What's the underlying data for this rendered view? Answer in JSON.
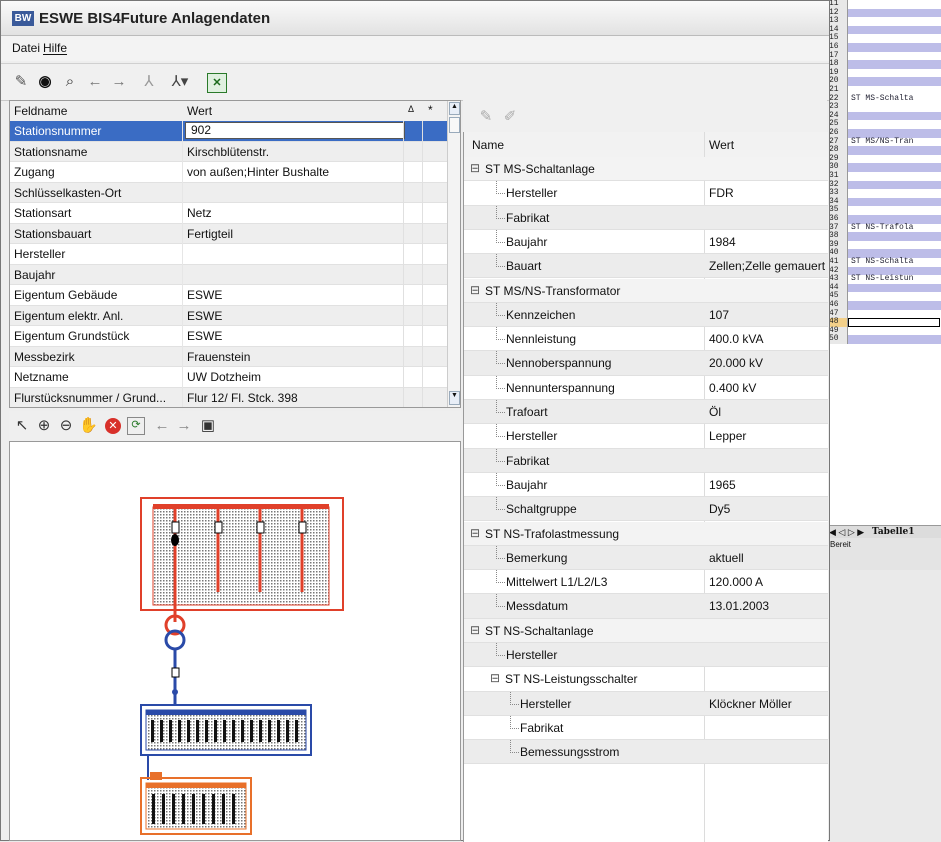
{
  "window": {
    "title": "ESWE BIS4Future Anlagendaten",
    "logo_text": "BW"
  },
  "menu": {
    "items": [
      "Datei",
      "Hilfe"
    ]
  },
  "toolbar1": {
    "icons": [
      "edit-icon",
      "binoculars-icon",
      "find-icon",
      "back-arrow-icon",
      "forward-arrow-icon",
      "tree-icon",
      "tree-dropdown-icon",
      "excel-icon"
    ]
  },
  "left_grid": {
    "headers": {
      "name": "Feldname",
      "value": "Wert",
      "sort": "Δ",
      "star": "*"
    },
    "rows": [
      {
        "field": "Stationsnummer",
        "value": "902"
      },
      {
        "field": "Stationsname",
        "value": "Kirschblütenstr."
      },
      {
        "field": "Zugang",
        "value": "von außen;Hinter Bushalte"
      },
      {
        "field": "Schlüsselkasten-Ort",
        "value": ""
      },
      {
        "field": "Stationsart",
        "value": "Netz"
      },
      {
        "field": "Stationsbauart",
        "value": "Fertigteil"
      },
      {
        "field": "Hersteller",
        "value": ""
      },
      {
        "field": "Baujahr",
        "value": ""
      },
      {
        "field": "Eigentum Gebäude",
        "value": "ESWE"
      },
      {
        "field": "Eigentum elektr. Anl.",
        "value": "ESWE"
      },
      {
        "field": "Eigentum Grundstück",
        "value": "ESWE"
      },
      {
        "field": "Messbezirk",
        "value": "Frauenstein"
      },
      {
        "field": "Netzname",
        "value": "UW Dotzheim"
      },
      {
        "field": "Flurstücksnummer / Grund...",
        "value": "Flur 12/ Fl. Stck. 398"
      }
    ]
  },
  "right_grid": {
    "headers": {
      "name": "Name",
      "value": "Wert"
    },
    "rows": [
      {
        "name": "ST MS-Schaltanlage",
        "value": "",
        "level": 0,
        "group": true
      },
      {
        "name": "Hersteller",
        "value": "FDR",
        "level": 1
      },
      {
        "name": "Fabrikat",
        "value": "",
        "level": 1
      },
      {
        "name": "Baujahr",
        "value": "1984",
        "level": 1
      },
      {
        "name": "Bauart",
        "value": "Zellen;Zelle gemauert",
        "level": 1
      },
      {
        "name": "ST MS/NS-Transformator",
        "value": "",
        "level": 0,
        "group": true
      },
      {
        "name": "Kennzeichen",
        "value": "107",
        "level": 1
      },
      {
        "name": "Nennleistung",
        "value": "400.0 kVA",
        "level": 1
      },
      {
        "name": "Nennoberspannung",
        "value": "20.000 kV",
        "level": 1
      },
      {
        "name": "Nennunterspannung",
        "value": "0.400 kV",
        "level": 1
      },
      {
        "name": "Trafoart",
        "value": "Öl",
        "level": 1
      },
      {
        "name": "Hersteller",
        "value": "Lepper",
        "level": 1
      },
      {
        "name": "Fabrikat",
        "value": "",
        "level": 1
      },
      {
        "name": "Baujahr",
        "value": "1965",
        "level": 1
      },
      {
        "name": "Schaltgruppe",
        "value": "Dy5",
        "level": 1
      },
      {
        "name": "ST NS-Trafolastmessung",
        "value": "",
        "level": 0,
        "group": true
      },
      {
        "name": "Bemerkung",
        "value": "aktuell",
        "level": 1
      },
      {
        "name": "Mittelwert L1/L2/L3",
        "value": "120.000 A",
        "level": 1
      },
      {
        "name": "Messdatum",
        "value": "13.01.2003",
        "level": 1
      },
      {
        "name": "ST NS-Schaltanlage",
        "value": "",
        "level": 0,
        "group": true
      },
      {
        "name": "Hersteller",
        "value": "",
        "level": 1
      },
      {
        "name": "ST NS-Leistungsschalter",
        "value": "",
        "level": 1,
        "group": true
      },
      {
        "name": "Hersteller",
        "value": "Klöckner Möller",
        "level": 2
      },
      {
        "name": "Fabrikat",
        "value": "",
        "level": 2
      },
      {
        "name": "Bemessungsstrom",
        "value": "",
        "level": 2
      }
    ]
  },
  "spreadsheet": {
    "rows": [
      {
        "n": "11",
        "t": ""
      },
      {
        "n": "12",
        "t": ""
      },
      {
        "n": "13",
        "t": ""
      },
      {
        "n": "14",
        "t": ""
      },
      {
        "n": "15",
        "t": ""
      },
      {
        "n": "16",
        "t": ""
      },
      {
        "n": "17",
        "t": ""
      },
      {
        "n": "18",
        "t": ""
      },
      {
        "n": "19",
        "t": ""
      },
      {
        "n": "20",
        "t": ""
      },
      {
        "n": "21",
        "t": ""
      },
      {
        "n": "22",
        "t": "ST MS-Schalta"
      },
      {
        "n": "23",
        "t": ""
      },
      {
        "n": "24",
        "t": ""
      },
      {
        "n": "25",
        "t": ""
      },
      {
        "n": "26",
        "t": ""
      },
      {
        "n": "27",
        "t": "ST MS/NS-Tran"
      },
      {
        "n": "28",
        "t": ""
      },
      {
        "n": "29",
        "t": ""
      },
      {
        "n": "30",
        "t": ""
      },
      {
        "n": "31",
        "t": ""
      },
      {
        "n": "32",
        "t": ""
      },
      {
        "n": "33",
        "t": ""
      },
      {
        "n": "34",
        "t": ""
      },
      {
        "n": "35",
        "t": ""
      },
      {
        "n": "36",
        "t": ""
      },
      {
        "n": "37",
        "t": "ST NS-Trafola"
      },
      {
        "n": "38",
        "t": ""
      },
      {
        "n": "39",
        "t": ""
      },
      {
        "n": "40",
        "t": ""
      },
      {
        "n": "41",
        "t": "ST NS-Schalta"
      },
      {
        "n": "42",
        "t": ""
      },
      {
        "n": "43",
        "t": "ST NS-Leistun"
      },
      {
        "n": "44",
        "t": ""
      },
      {
        "n": "45",
        "t": ""
      },
      {
        "n": "46",
        "t": ""
      },
      {
        "n": "47",
        "t": ""
      },
      {
        "n": "48",
        "t": ""
      },
      {
        "n": "49",
        "t": ""
      },
      {
        "n": "50",
        "t": ""
      }
    ],
    "sheet_tab": "Tabelle1",
    "status": "Bereit"
  }
}
